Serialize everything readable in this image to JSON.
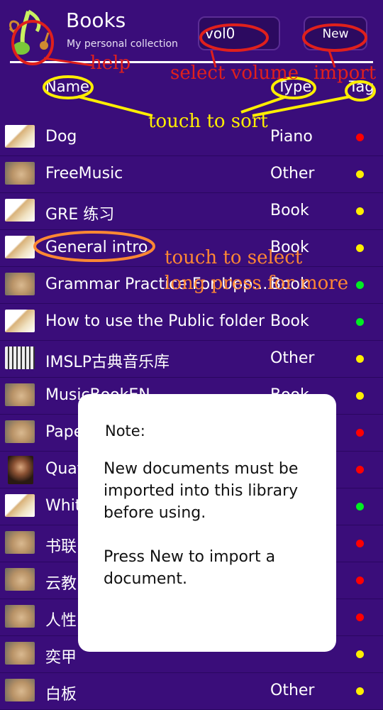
{
  "header": {
    "title": "Books",
    "subtitle": "My personal collection",
    "volume_label": "vol0",
    "new_label": "New"
  },
  "columns": {
    "name": "Name",
    "type": "Type",
    "tag": "Tag"
  },
  "colors": {
    "background": "#3a0d7a",
    "tag_red": "#ff0000",
    "tag_yellow": "#ffee00",
    "tag_green": "#00ee22",
    "annotation_red": "#e0201c",
    "annotation_yellow": "#ffee00",
    "annotation_orange": "#ff8833"
  },
  "books": [
    {
      "name": "Dog",
      "type": "Piano",
      "tag": "red",
      "thumb": "dog"
    },
    {
      "name": "FreeMusic",
      "type": "Other",
      "tag": "yellow",
      "thumb": "hamster"
    },
    {
      "name": "GRE 练习",
      "type": "Book",
      "tag": "yellow",
      "thumb": "dog"
    },
    {
      "name": "General intro",
      "type": "Book",
      "tag": "yellow",
      "thumb": "dog"
    },
    {
      "name": "Grammar Practice For Upp...",
      "type": "Book",
      "tag": "green",
      "thumb": "hamster"
    },
    {
      "name": "How to use the Public folder",
      "type": "Book",
      "tag": "green",
      "thumb": "dog"
    },
    {
      "name": "IMSLP古典音乐库",
      "type": "Other",
      "tag": "yellow",
      "thumb": "piano"
    },
    {
      "name": "MusicBookEN",
      "type": "Book",
      "tag": "yellow",
      "thumb": "hamster"
    },
    {
      "name": "Pape",
      "type": "",
      "tag": "red",
      "thumb": "hamster"
    },
    {
      "name": "Quat",
      "type": "",
      "tag": "red",
      "thumb": "portrait"
    },
    {
      "name": "Whit",
      "type": "",
      "tag": "green",
      "thumb": "dog"
    },
    {
      "name": "书联",
      "type": "",
      "tag": "red",
      "thumb": "hamster"
    },
    {
      "name": "云教",
      "type": "",
      "tag": "red",
      "thumb": "hamster"
    },
    {
      "name": "人性",
      "type": "",
      "tag": "red",
      "thumb": "hamster"
    },
    {
      "name": "奕甲",
      "type": "",
      "tag": "yellow",
      "thumb": "hamster"
    },
    {
      "name": "白板",
      "type": "Other",
      "tag": "yellow",
      "thumb": "hamster"
    }
  ],
  "annotations": {
    "help": "help",
    "select_volume": "select volume",
    "import": "import",
    "touch_to_sort": "touch to sort",
    "touch_to_select": "touch to select",
    "long_press": "long press for more"
  },
  "dialog": {
    "title": "Note:",
    "line1": "New documents must be imported into this library before using.",
    "line2": "Press New to import a document."
  }
}
